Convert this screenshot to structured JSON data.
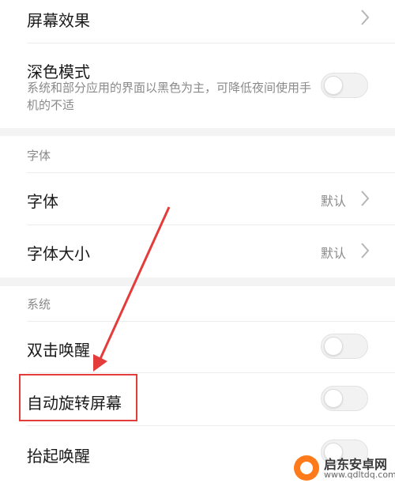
{
  "rows": {
    "screen_effect": {
      "title": "屏幕效果"
    },
    "dark_mode": {
      "title": "深色模式",
      "desc": "系统和部分应用的界面以黑色为主，可降低夜间使用手机的不适",
      "toggle_on": false
    },
    "font": {
      "title": "字体",
      "value": "默认"
    },
    "font_size": {
      "title": "字体大小",
      "value": "默认"
    },
    "double_tap_wake": {
      "title": "双击唤醒",
      "toggle_on": false
    },
    "auto_rotate": {
      "title": "自动旋转屏幕",
      "toggle_on": false
    },
    "raise_to_wake": {
      "title": "抬起唤醒",
      "toggle_on": false
    }
  },
  "sections": {
    "font_header": "字体",
    "system_header": "系统"
  },
  "watermark": {
    "title": "启东安卓网",
    "url": "www.qdltdq.com"
  },
  "colors": {
    "annotation_red": "#e43b3b",
    "section_gap": "#f3f3f3",
    "secondary_text": "#8a8a8a"
  }
}
